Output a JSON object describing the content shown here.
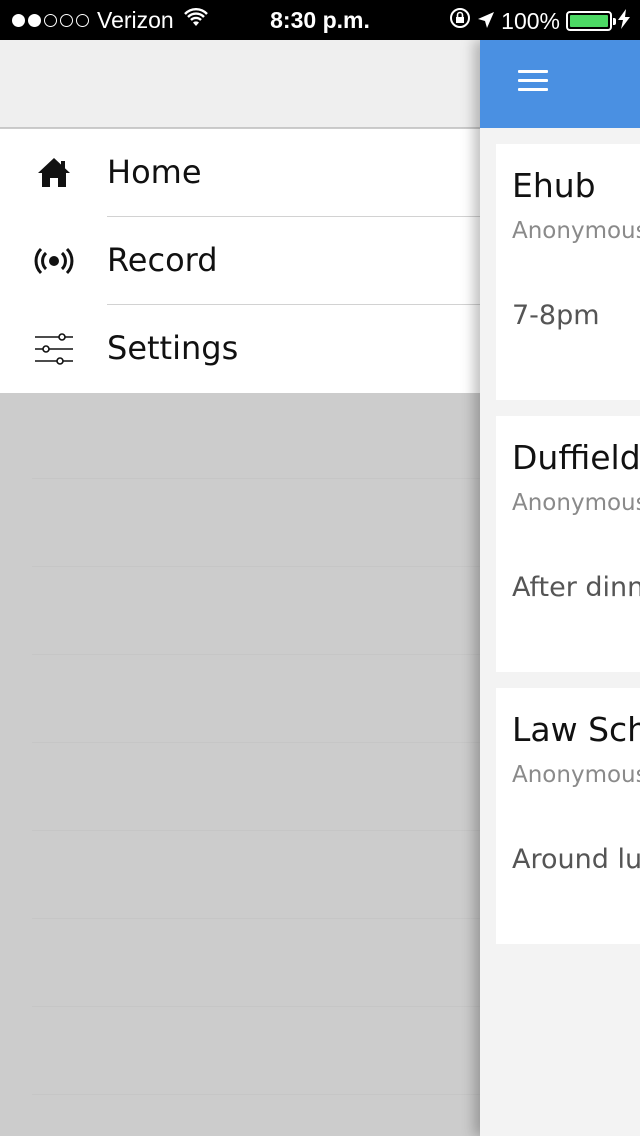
{
  "status_bar": {
    "carrier": "Verizon",
    "signal_dots_filled": 2,
    "signal_dots_total": 5,
    "time": "8:30 p.m.",
    "battery": "100%"
  },
  "drawer": {
    "items": [
      {
        "label": "Home",
        "icon": "home-icon"
      },
      {
        "label": "Record",
        "icon": "broadcast-icon"
      },
      {
        "label": "Settings",
        "icon": "sliders-icon"
      }
    ]
  },
  "main": {
    "topbar": {
      "menu_icon": "hamburger-menu-icon",
      "color": "#4a90e2"
    },
    "cards": [
      {
        "title": "Ehub",
        "subtitle": "Anonymous",
        "body": "7-8pm"
      },
      {
        "title": "Duffield",
        "subtitle": "Anonymous",
        "body": "After dinn"
      },
      {
        "title": "Law Sch",
        "subtitle": "Anonymous",
        "body": "Around lu"
      }
    ]
  }
}
